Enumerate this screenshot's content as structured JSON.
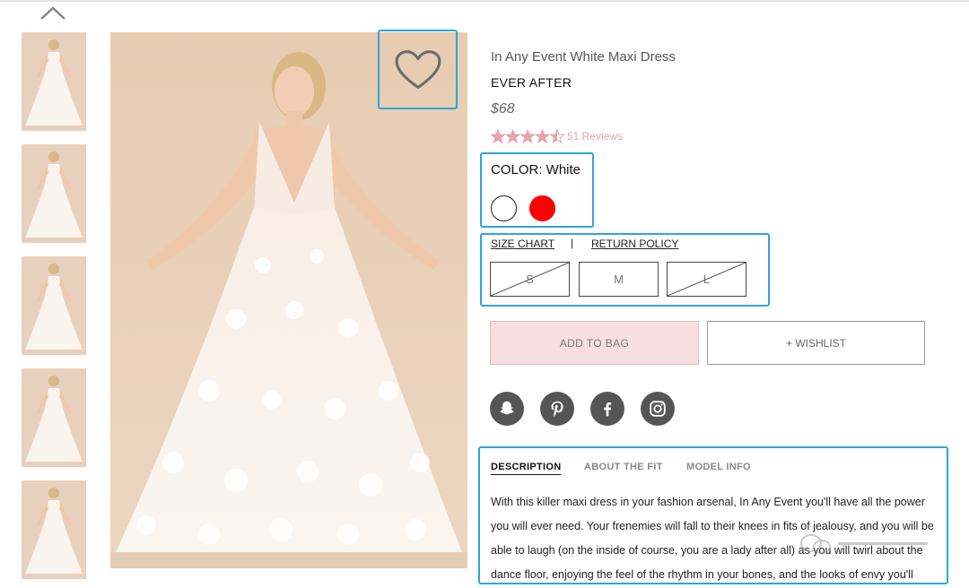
{
  "product": {
    "title": "In Any Event White Maxi Dress",
    "brand": "EVER AFTER",
    "price": "$68",
    "rating": 4.5,
    "rating_max": 5,
    "reviews_label": "51 Reviews"
  },
  "color": {
    "label": "COLOR: White",
    "options": [
      {
        "name": "white-swatch",
        "hex": "#ffffff"
      },
      {
        "name": "red-swatch",
        "hex": "#ff0000"
      }
    ]
  },
  "links": {
    "size_chart": "SIZE CHART",
    "separator": "|",
    "return_policy": "RETURN POLICY"
  },
  "sizes": [
    {
      "label": "S",
      "available": false
    },
    {
      "label": "M",
      "available": true
    },
    {
      "label": "L",
      "available": false
    }
  ],
  "actions": {
    "add_to_bag": "ADD TO BAG",
    "wishlist": "+ WISHLIST"
  },
  "social_icons": [
    "snapchat-icon",
    "pinterest-icon",
    "facebook-icon",
    "instagram-icon"
  ],
  "tabs": [
    {
      "label": "DESCRIPTION",
      "active": true
    },
    {
      "label": "ABOUT THE FIT",
      "active": false
    },
    {
      "label": "MODEL INFO",
      "active": false
    }
  ],
  "description": "With this killer maxi dress in your fashion arsenal, In Any Event you'll have all the power you will ever need. Your frenemies will fall to their knees in fits of jealousy, and you will be able to laugh (on the inside of course, you are a lady after all) as you will twirl about the dance floor, enjoying the feel of the rhythm in your bones, and the looks of envy you'll",
  "colors": {
    "accent_pink": "#f8dee2",
    "star": "#e8a3ad",
    "highlight": "#2aa7dd",
    "icon_grey": "#555555"
  }
}
